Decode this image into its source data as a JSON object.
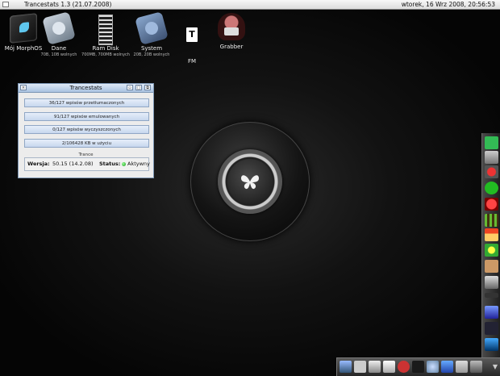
{
  "menubar": {
    "title": "Trancestats 1.3 (21.07.2008)",
    "clock": "wtorek, 16 Wrz 2008, 20:56:53"
  },
  "desktop_icons": [
    {
      "label": "Mój MorphOS",
      "sub": "",
      "icon": "morphos-drive-icon"
    },
    {
      "label": "Dane",
      "sub": "70B, 10B wolnych",
      "icon": "hard-disk-icon"
    },
    {
      "label": "Ram Disk",
      "sub": "700MB, 700MB wolnych",
      "icon": "ram-disk-icon"
    },
    {
      "label": "System",
      "sub": "20B, 20B wolnych",
      "icon": "system-disk-icon"
    },
    {
      "label": "FM",
      "sub": "",
      "icon": "document-icon"
    },
    {
      "label": "Grabber",
      "sub": "",
      "icon": "grabber-icon"
    }
  ],
  "window": {
    "title": "Trancestats",
    "rows": [
      "36/127 wpisów przetłumaczonych",
      "91/127 wpisów emulowanych",
      "0/127 wpisów wyczyszczonych",
      "2/106428 KB w użyciu"
    ],
    "group_label": "Trance",
    "version_key": "Wersja:",
    "version_value": "50.15 (14.2.08)",
    "status_key": "Status:",
    "status_value": "Aktywny"
  },
  "colors": {
    "window_title_bar": "#a9c2e0",
    "status_dot": "#1a9a1a",
    "desktop_bg": "#050505"
  }
}
